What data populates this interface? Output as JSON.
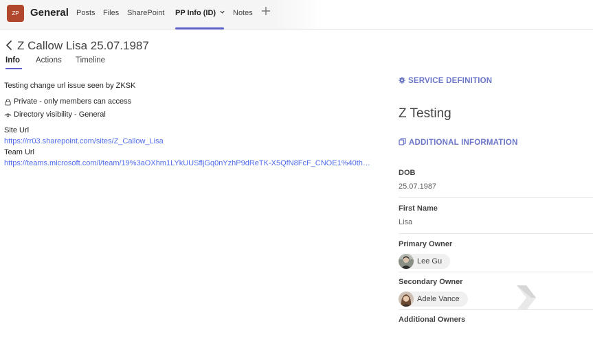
{
  "topbar": {
    "team_initials": "ZP",
    "channel": "General",
    "tabs": [
      {
        "label": "Posts"
      },
      {
        "label": "Files"
      },
      {
        "label": "SharePoint"
      },
      {
        "label": "PP Info (ID)",
        "active": true
      },
      {
        "label": "Notes"
      }
    ],
    "add_tab_icon": "plus-icon",
    "dropdown_icon": "chevron-down-icon"
  },
  "header": {
    "title": "Z Callow Lisa 25.07.1987",
    "subtabs": [
      {
        "label": "Info",
        "active": true
      },
      {
        "label": "Actions"
      },
      {
        "label": "Timeline"
      }
    ]
  },
  "info": {
    "description": "Testing change url issue seen by ZKSK",
    "privacy": "Private - only members can access",
    "visibility": "Directory visibility - General",
    "site_url_label": "Site Url",
    "site_url": "https://rr03.sharepoint.com/sites/Z_Callow_Lisa",
    "team_url_label": "Team Url",
    "team_url": "https://teams.microsoft.com/l/team/19%3aOXhm1LYkUUSfljGq0nYzhP9dReTK-X5QfN8FcF_CNOE1%40th…"
  },
  "panel": {
    "service_definition_heading": "SERVICE DEFINITION",
    "service_definition_value": "Z Testing",
    "additional_info_heading": "ADDITIONAL INFORMATION",
    "fields": [
      {
        "label": "DOB",
        "value": "25.07.1987"
      },
      {
        "label": "First Name",
        "value": "Lisa"
      },
      {
        "label": "Primary Owner",
        "person": "Lee Gu"
      },
      {
        "label": "Secondary Owner",
        "person": "Adele Vance"
      },
      {
        "label": "Additional Owners"
      }
    ]
  },
  "colors": {
    "accent": "#5b5fc7",
    "link": "#4f6bed",
    "section_heading": "#6b76c9",
    "team_avatar": "#b1482e"
  }
}
